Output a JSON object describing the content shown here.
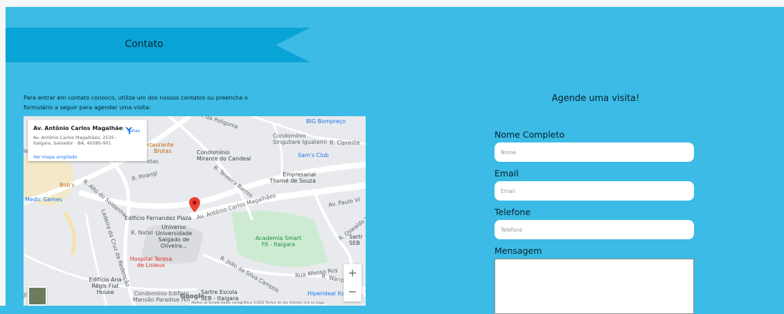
{
  "section": {
    "title": "Contato"
  },
  "intro": {
    "text": "Para entrar em contato conosco, utilize um dos nossos contatos ou preencha o formulário a seguir para agendar uma visita:"
  },
  "map": {
    "place_name": "Av. Antônio Carlos Magalhães...",
    "address": "Av. Antônio Carlos Magalhães, 2535 - Itaigara, Salvador - BA, 40280-901",
    "directions_label": "Rotas",
    "enlarge_link": "Ver mapa ampliado",
    "labels": {
      "poligonia": "R. da Poligonia",
      "bigbompreco": "BIG Bompreço",
      "condominio_singullare": "Condomínio Singullare Iguatemi",
      "cipreste": "R. Cipreste",
      "restaurante": "staurante",
      "brotas": "Brotas",
      "ot": "otas",
      "condominio_mirante": "Condomínio Mirante do Candeal",
      "sams_club": "Sam's Club",
      "pirangi": "R. Pirangi",
      "teixeira": "R. Teixeira Barros",
      "empresarial": "Empresarial Thomé de Souza",
      "bobs": "Bob's",
      "le": "le",
      "medic_games": "Medic Games",
      "alto_saldanha": "R. Alto do Saldanha",
      "acm": "Av. Antônio Carlos Magalhães",
      "paulo_vi": "Av. Paulo VI",
      "fernandez": "Edifício Fernandez Plaza",
      "natal": "R. Natal",
      "universo": "Universo Universidade Salgado de Oliveira...",
      "osvaldo": "R. Oswaldo Valente",
      "cruz_redencao": "Ladeira da Cruz da Redenção",
      "academia": "Academia Smart Fit - Itaigara",
      "sartr": "Sartr SEB",
      "hospital": "Hospital Teresa de Lisieux",
      "afonso_ruy": "Rua Afonso Ruy",
      "joao_silva": "R. João da Silva Campos",
      "wanderley": "R. Wanderley",
      "ana": "Edifício Ana Régis Flat House",
      "hiperideal": "Hiperideal Itai",
      "ji": "Ji",
      "mansao": "Condomínio Edifício Mansão Paradise Hill",
      "sartre": "Sartre Escola SEB - Itaigara",
      "google": "Google",
      "attribution": "Atalhos do teclado   Dados cartográficos ©2022   Termos de Uso   Informar erro no mapa"
    },
    "zoom_in": "+",
    "zoom_out": "−"
  },
  "form": {
    "title": "Agende uma visita!",
    "name_label": "Nome Completo",
    "name_placeholder": "Nome",
    "email_label": "Email",
    "email_placeholder": "Email",
    "phone_label": "Telefone",
    "phone_placeholder": "Telefone",
    "message_label": "Mensagem"
  },
  "colors": {
    "background": "#3bbbe5",
    "ribbon": "#0aa3d6",
    "marker": "#ea4335"
  }
}
